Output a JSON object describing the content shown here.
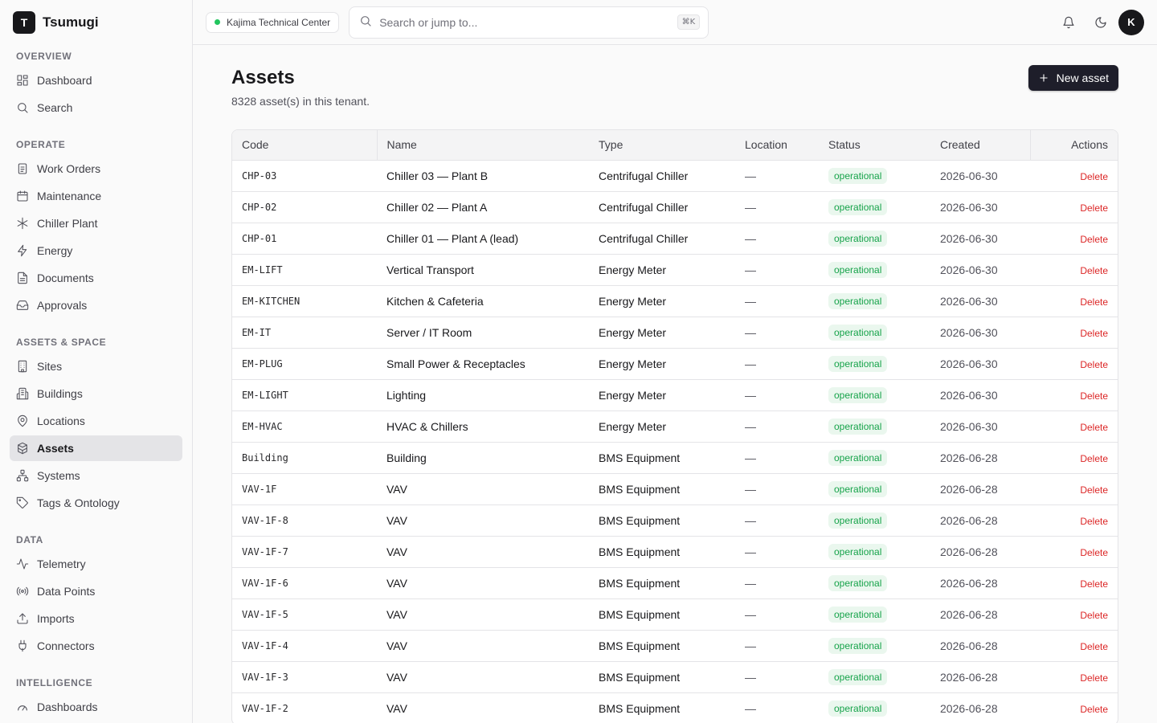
{
  "brand": {
    "logo_letter": "T",
    "name": "Tsumugi"
  },
  "sidebar": {
    "sections": [
      {
        "heading": "OVERVIEW",
        "items": [
          {
            "label": "Dashboard",
            "icon": "layout-dashboard-icon"
          },
          {
            "label": "Search",
            "icon": "search-icon"
          }
        ]
      },
      {
        "heading": "OPERATE",
        "items": [
          {
            "label": "Work Orders",
            "icon": "clipboard-icon"
          },
          {
            "label": "Maintenance",
            "icon": "calendar-icon"
          },
          {
            "label": "Chiller Plant",
            "icon": "snowflake-icon"
          },
          {
            "label": "Energy",
            "icon": "zap-icon"
          },
          {
            "label": "Documents",
            "icon": "file-text-icon"
          },
          {
            "label": "Approvals",
            "icon": "inbox-icon"
          }
        ]
      },
      {
        "heading": "ASSETS & SPACE",
        "items": [
          {
            "label": "Sites",
            "icon": "building-icon"
          },
          {
            "label": "Buildings",
            "icon": "building-2-icon"
          },
          {
            "label": "Locations",
            "icon": "map-pin-icon"
          },
          {
            "label": "Assets",
            "icon": "boxes-icon",
            "active": true
          },
          {
            "label": "Systems",
            "icon": "network-icon"
          },
          {
            "label": "Tags & Ontology",
            "icon": "tag-icon"
          }
        ]
      },
      {
        "heading": "DATA",
        "items": [
          {
            "label": "Telemetry",
            "icon": "activity-icon"
          },
          {
            "label": "Data Points",
            "icon": "radio-icon"
          },
          {
            "label": "Imports",
            "icon": "upload-icon"
          },
          {
            "label": "Connectors",
            "icon": "plug-icon"
          }
        ]
      },
      {
        "heading": "INTELLIGENCE",
        "items": [
          {
            "label": "Dashboards",
            "icon": "gauge-icon"
          }
        ]
      }
    ]
  },
  "topbar": {
    "tenant": "Kajima Technical Center",
    "search_placeholder": "Search or jump to...",
    "search_shortcut": "⌘K",
    "avatar_letter": "K"
  },
  "page": {
    "title": "Assets",
    "subtitle": "8328 asset(s) in this tenant.",
    "new_button": "New asset"
  },
  "table": {
    "columns": [
      "Code",
      "Name",
      "Type",
      "Location",
      "Status",
      "Created",
      "Actions"
    ],
    "delete_label": "Delete",
    "rows": [
      {
        "code": "CHP-03",
        "name": "Chiller 03 — Plant B",
        "type": "Centrifugal Chiller",
        "location": "—",
        "status": "operational",
        "created": "2026-06-30"
      },
      {
        "code": "CHP-02",
        "name": "Chiller 02 — Plant A",
        "type": "Centrifugal Chiller",
        "location": "—",
        "status": "operational",
        "created": "2026-06-30"
      },
      {
        "code": "CHP-01",
        "name": "Chiller 01 — Plant A (lead)",
        "type": "Centrifugal Chiller",
        "location": "—",
        "status": "operational",
        "created": "2026-06-30"
      },
      {
        "code": "EM-LIFT",
        "name": "Vertical Transport",
        "type": "Energy Meter",
        "location": "—",
        "status": "operational",
        "created": "2026-06-30"
      },
      {
        "code": "EM-KITCHEN",
        "name": "Kitchen & Cafeteria",
        "type": "Energy Meter",
        "location": "—",
        "status": "operational",
        "created": "2026-06-30"
      },
      {
        "code": "EM-IT",
        "name": "Server / IT Room",
        "type": "Energy Meter",
        "location": "—",
        "status": "operational",
        "created": "2026-06-30"
      },
      {
        "code": "EM-PLUG",
        "name": "Small Power & Receptacles",
        "type": "Energy Meter",
        "location": "—",
        "status": "operational",
        "created": "2026-06-30"
      },
      {
        "code": "EM-LIGHT",
        "name": "Lighting",
        "type": "Energy Meter",
        "location": "—",
        "status": "operational",
        "created": "2026-06-30"
      },
      {
        "code": "EM-HVAC",
        "name": "HVAC & Chillers",
        "type": "Energy Meter",
        "location": "—",
        "status": "operational",
        "created": "2026-06-30"
      },
      {
        "code": "Building",
        "name": "Building",
        "type": "BMS Equipment",
        "location": "—",
        "status": "operational",
        "created": "2026-06-28"
      },
      {
        "code": "VAV-1F",
        "name": "VAV",
        "type": "BMS Equipment",
        "location": "—",
        "status": "operational",
        "created": "2026-06-28"
      },
      {
        "code": "VAV-1F-8",
        "name": "VAV",
        "type": "BMS Equipment",
        "location": "—",
        "status": "operational",
        "created": "2026-06-28"
      },
      {
        "code": "VAV-1F-7",
        "name": "VAV",
        "type": "BMS Equipment",
        "location": "—",
        "status": "operational",
        "created": "2026-06-28"
      },
      {
        "code": "VAV-1F-6",
        "name": "VAV",
        "type": "BMS Equipment",
        "location": "—",
        "status": "operational",
        "created": "2026-06-28"
      },
      {
        "code": "VAV-1F-5",
        "name": "VAV",
        "type": "BMS Equipment",
        "location": "—",
        "status": "operational",
        "created": "2026-06-28"
      },
      {
        "code": "VAV-1F-4",
        "name": "VAV",
        "type": "BMS Equipment",
        "location": "—",
        "status": "operational",
        "created": "2026-06-28"
      },
      {
        "code": "VAV-1F-3",
        "name": "VAV",
        "type": "BMS Equipment",
        "location": "—",
        "status": "operational",
        "created": "2026-06-28"
      },
      {
        "code": "VAV-1F-2",
        "name": "VAV",
        "type": "BMS Equipment",
        "location": "—",
        "status": "operational",
        "created": "2026-06-28"
      }
    ]
  },
  "colors": {
    "accent": "#18181b",
    "status_operational": "#16a34a",
    "delete": "#dc2626",
    "tenant_dot": "#22c55e"
  }
}
